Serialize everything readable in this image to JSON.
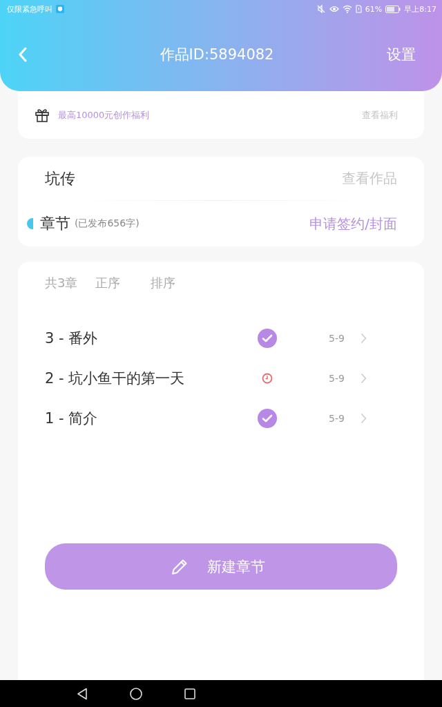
{
  "status_bar": {
    "carrier": "仅限紧急呼叫",
    "battery": "61%",
    "time": "早上8:17"
  },
  "header": {
    "title": "作品ID:5894082",
    "action": "设置"
  },
  "bonus": {
    "text": "最高10000元创作福利",
    "link": "查看福利"
  },
  "work": {
    "title": "坑传",
    "view": "查看作品",
    "section": "章节",
    "published": "(已发布656字)",
    "apply": "申请签约/封面"
  },
  "chapters_header": {
    "count": "共3章",
    "order": "正序",
    "sort": "排序"
  },
  "chapters": [
    {
      "title": "3 - 番外",
      "kind": "published",
      "date": "5-9"
    },
    {
      "title": "2 - 坑小鱼干的第一天",
      "kind": "scheduled",
      "date": "5-9"
    },
    {
      "title": "1 - 简介",
      "kind": "published",
      "date": "5-9"
    }
  ],
  "new_button": "新建章节"
}
